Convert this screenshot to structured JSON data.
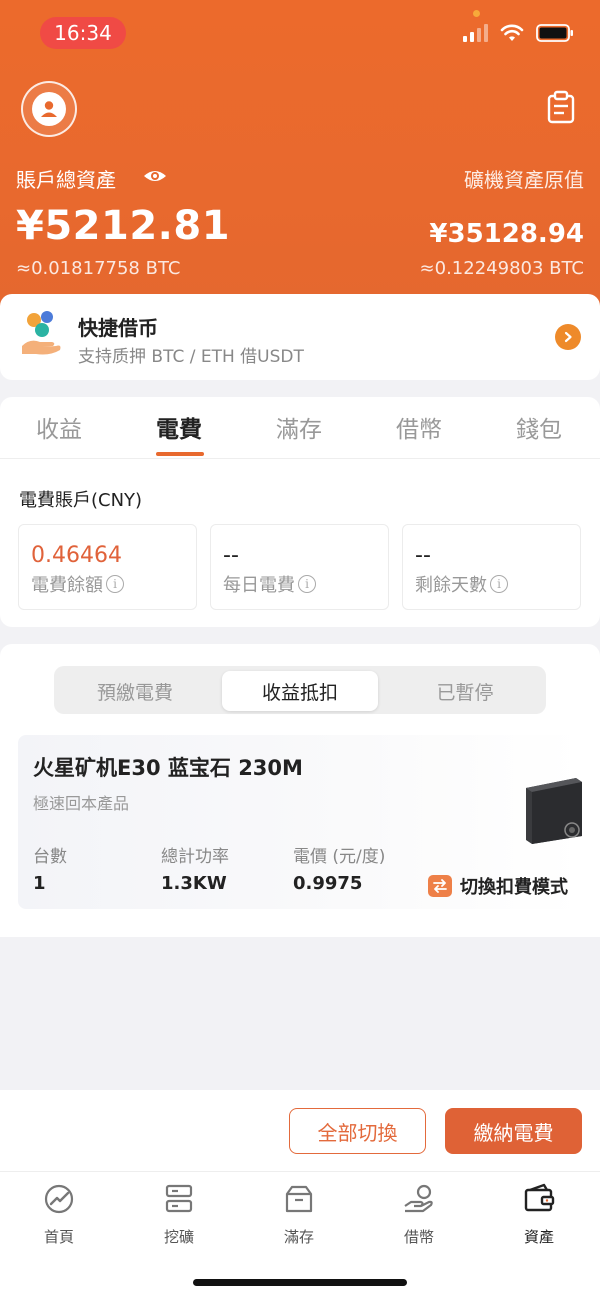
{
  "status_bar": {
    "time": "16:34"
  },
  "header": {
    "total_assets_label": "賬戶總資產",
    "total_assets_value": "¥5212.81",
    "total_assets_btc": "≈0.01817758 BTC",
    "miner_assets_label": "礦機資產原值",
    "miner_assets_value": "¥35128.94",
    "miner_assets_btc": "≈0.12249803 BTC"
  },
  "quick_loan": {
    "title": "快捷借币",
    "subtitle": "支持质押 BTC / ETH 借USDT"
  },
  "tabs": [
    "收益",
    "電費",
    "滿存",
    "借幣",
    "錢包"
  ],
  "electricity": {
    "section_title": "電費賬戶(CNY)",
    "stats": [
      {
        "value": "0.46464",
        "label": "電費餘額"
      },
      {
        "value": "--",
        "label": "每日電費"
      },
      {
        "value": "--",
        "label": "剩餘天數"
      }
    ]
  },
  "segments": [
    "預繳電費",
    "收益抵扣",
    "已暫停"
  ],
  "product": {
    "title": "火星矿机E30 蓝宝石 230M",
    "subtitle": "極速回本產品",
    "columns": [
      {
        "label": "台數",
        "value": "1"
      },
      {
        "label": "總計功率",
        "value": "1.3KW"
      },
      {
        "label": "電價 (元/度)",
        "value": "0.9975"
      }
    ],
    "switch_mode": "切換扣費模式"
  },
  "actions": {
    "switch_all": "全部切換",
    "pay": "繳納電費"
  },
  "nav": [
    "首頁",
    "挖礦",
    "滿存",
    "借幣",
    "資產"
  ],
  "colors": {
    "brand": "#e8692e",
    "accent_red": "#df6236",
    "time_pill": "#f04a45"
  }
}
